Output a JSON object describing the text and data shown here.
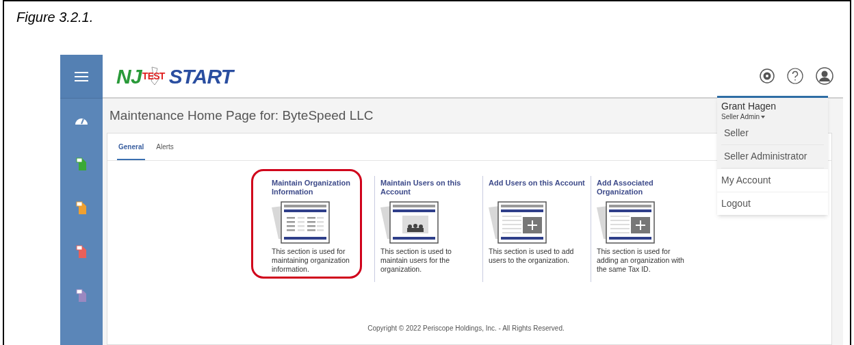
{
  "caption": "Figure 3.2.1.",
  "logo": {
    "left": "NJ",
    "right": "START",
    "overlay": "TEST"
  },
  "page_title": "Maintenance Home Page for: ByteSpeed LLC",
  "tabs": [
    {
      "label": "General",
      "selected": true
    },
    {
      "label": "Alerts",
      "selected": false
    }
  ],
  "sidebar": {
    "items": [
      {
        "kind": "dashboard"
      },
      {
        "kind": "document",
        "color": "#3aa935"
      },
      {
        "kind": "document",
        "color": "#f0a030"
      },
      {
        "kind": "document",
        "color": "#e8605a"
      },
      {
        "kind": "document",
        "color": "#9a88c0"
      }
    ]
  },
  "tiles": [
    {
      "title": "Maintain Organization Information",
      "kind": "list",
      "description": "This section is used for maintaining organization information.",
      "highlighted": true
    },
    {
      "title": "Maintain Users on this Account",
      "kind": "users",
      "description": "This section is used to maintain users for the organization.",
      "highlighted": false
    },
    {
      "title": "Add Users on this Account",
      "kind": "add",
      "description": "This section is used to add users to the organization.",
      "highlighted": false
    },
    {
      "title": "Add Associated Organization",
      "kind": "add",
      "description": "This section is used for adding an organization with the same Tax ID.",
      "highlighted": false
    }
  ],
  "footer": "Copyright © 2022 Periscope Holdings, Inc. - All Rights Reserved.",
  "user_menu": {
    "name": "Grant Hagen",
    "role": "Seller Admin",
    "roles": [
      "Seller",
      "Seller Administrator"
    ],
    "links": [
      "My Account",
      "Logout"
    ]
  }
}
